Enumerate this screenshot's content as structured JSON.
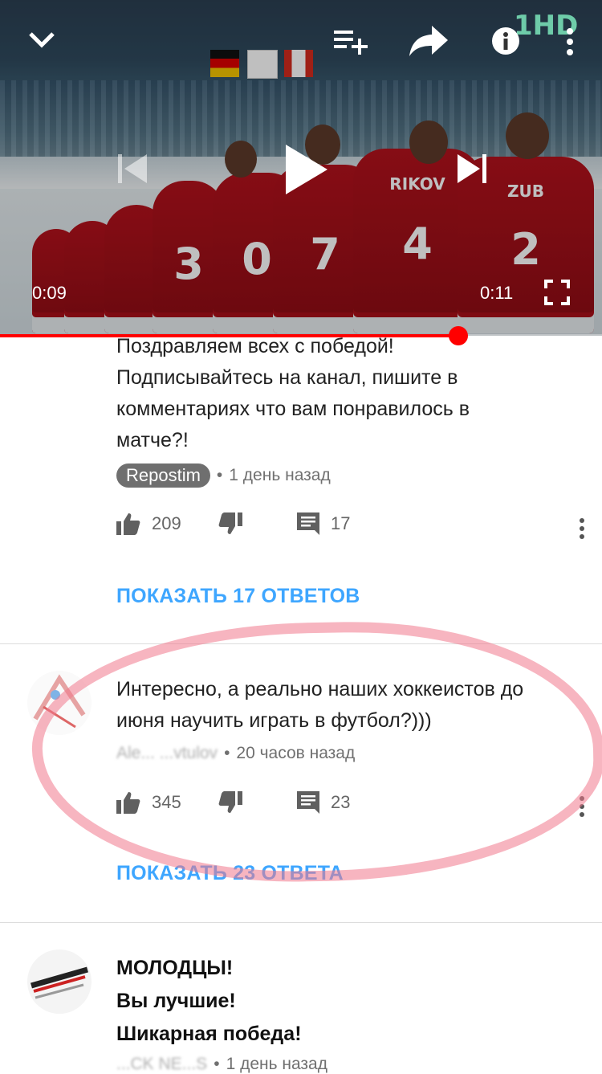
{
  "player": {
    "elapsed": "0:09",
    "duration": "0:11",
    "progress_fraction": 0.76,
    "channel_logo": "1HD",
    "jerseys": [
      {
        "name": "",
        "number": "3"
      },
      {
        "name": "",
        "number": "0"
      },
      {
        "name": "",
        "number": "7"
      },
      {
        "name": "RIKOV",
        "number": "4"
      },
      {
        "name": "ZUB",
        "number": "2"
      }
    ],
    "icons": [
      "chevron-down-icon",
      "add-to-queue-icon",
      "share-icon",
      "info-icon",
      "more-vert-icon",
      "previous-icon",
      "play-icon",
      "next-icon",
      "fullscreen-icon"
    ]
  },
  "comments": [
    {
      "text_lines": [
        "Поздравляем всех с победой!",
        "Подписывайтесь на канал, пишите в",
        "комментариях что вам понравилось в",
        "матче?!"
      ],
      "author": "Repostim",
      "time": "1 день назад",
      "likes": "209",
      "replies_count": "17",
      "show_replies": "ПОКАЗАТЬ 17 ОТВЕТОВ"
    },
    {
      "text_lines": [
        "Интересно, а реально наших хоккеистов до",
        "июня научить играть в футбол?)))"
      ],
      "author": "Ale... ...vtulov",
      "time": "20 часов назад",
      "likes": "345",
      "replies_count": "23",
      "show_replies": "ПОКАЗАТЬ 23 ОТВЕТА"
    },
    {
      "text_lines": [
        "МОЛОДЦЫ!",
        "Вы лучшие!",
        "Шикарная победа!"
      ],
      "author": "...CK NE...S",
      "time": "1 день назад"
    }
  ],
  "colors": {
    "accent": "#3ea6ff",
    "progress": "#ff0000",
    "highlight": "#f0788c"
  }
}
